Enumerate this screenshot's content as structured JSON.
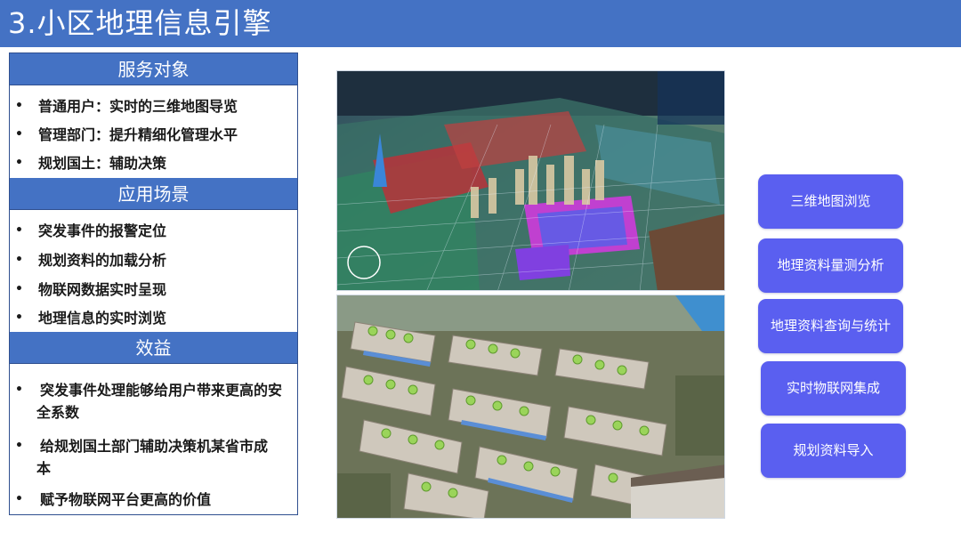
{
  "header": {
    "title": "3.小区地理信息引擎"
  },
  "sections": [
    {
      "title": "服务对象",
      "items": [
        "普通用户：实时的三维地图导览",
        "管理部门：提升精细化管理水平",
        "规划国土：辅助决策"
      ]
    },
    {
      "title": "应用场景",
      "items": [
        "突发事件的报警定位",
        "规划资料的加载分析",
        "物联网数据实时呈现",
        "地理信息的实时浏览"
      ]
    },
    {
      "title": "效益",
      "items": [
        "突发事件处理能够给用户带来更高的安全系数",
        "给规划国土部门辅助决策机某省市成本",
        "赋予物联网平台更高的价值"
      ]
    }
  ],
  "features": [
    "三维地图浏览",
    "地理资料量测分析",
    "地理资料查询与统计",
    "实时物联网集成",
    "规划资料导入"
  ],
  "bullet_char": "•",
  "colors": {
    "header_blue": "#4472c4",
    "button_purple": "#5a5ff0"
  }
}
